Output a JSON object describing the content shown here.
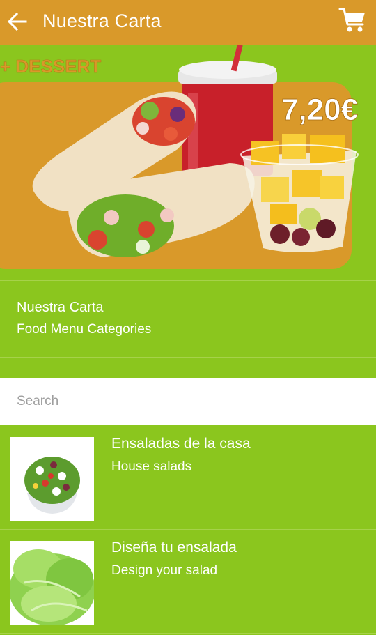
{
  "app_bar": {
    "title": "Nuestra Carta",
    "back_icon": "arrow-left-icon",
    "cart_icon": "shopping-cart-icon",
    "color": "#d9992a"
  },
  "banner": {
    "promo_text": "+ DESSERT",
    "price": "7,20€"
  },
  "header": {
    "title": "Nuestra Carta",
    "subtitle": "Food Menu Categories"
  },
  "search": {
    "placeholder": "Search"
  },
  "categories": [
    {
      "title": "Ensaladas de la casa",
      "subtitle": "House salads"
    },
    {
      "title": "Diseña tu ensalada",
      "subtitle": "Design your salad"
    }
  ],
  "colors": {
    "background": "#8bc61e",
    "accent": "#d9992a"
  }
}
